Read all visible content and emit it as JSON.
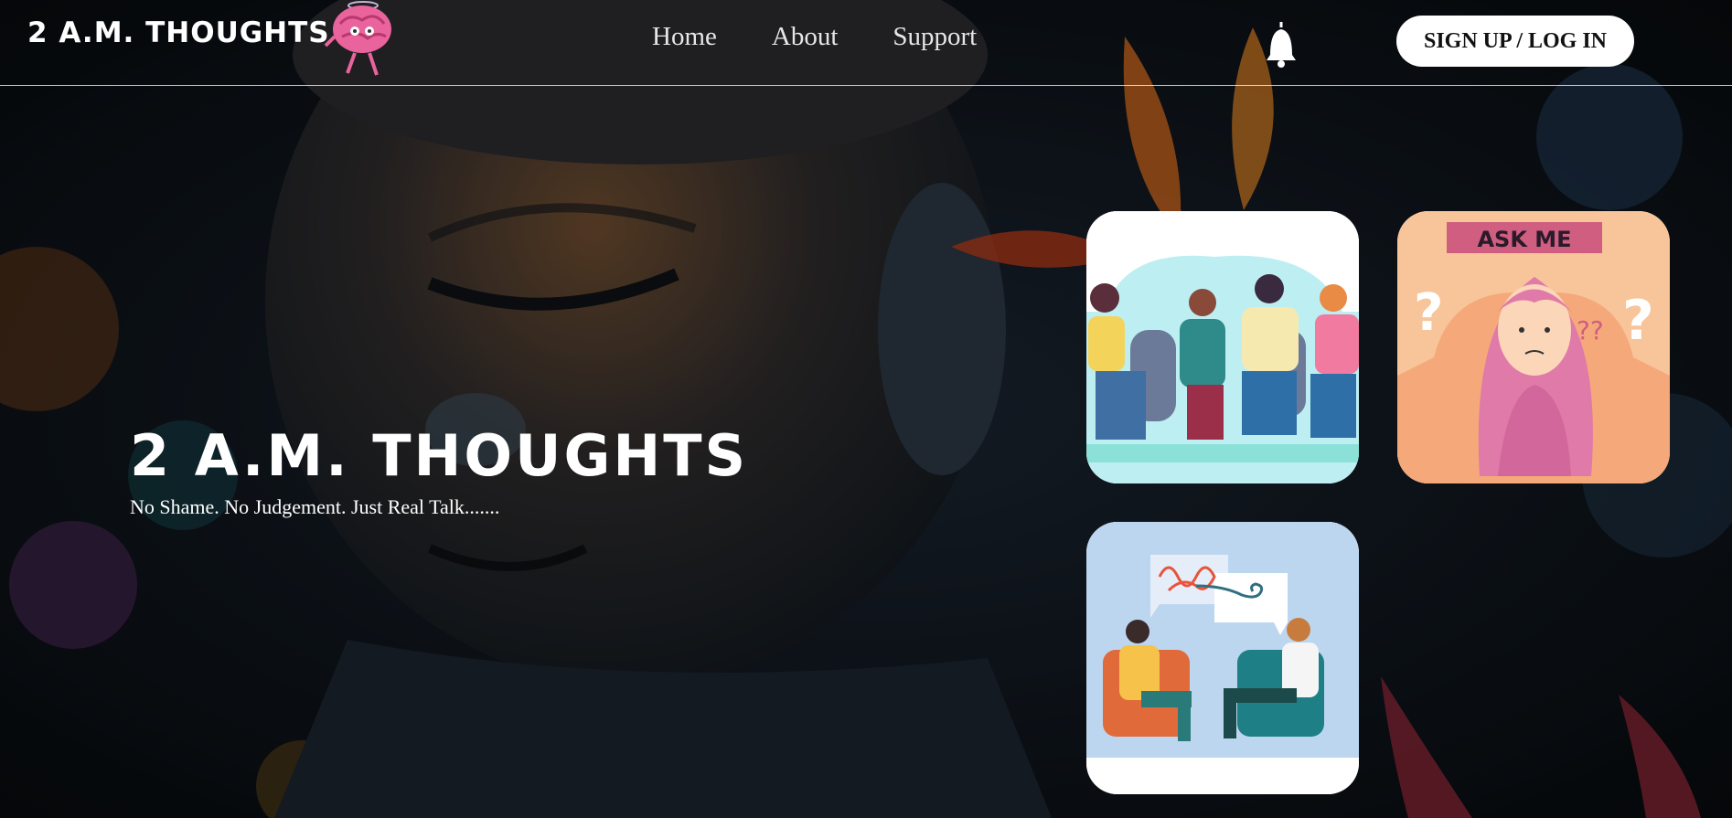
{
  "brand": {
    "name": "2 A.M. THOUGHTS",
    "logo_icon": "brain-mascot-icon"
  },
  "nav": {
    "links": [
      {
        "label": "Home"
      },
      {
        "label": "About"
      },
      {
        "label": "Support"
      }
    ],
    "bell_icon": "bell-icon",
    "cta_label": "SIGN UP / LOG IN"
  },
  "hero": {
    "title": "2 A.M. THOUGHTS",
    "tagline": "No Shame. No Judgement. Just Real Talk......."
  },
  "cards": {
    "group": {
      "name": "group-therapy-illustration"
    },
    "ask": {
      "banner": "ASK ME",
      "qmark_left": "?",
      "qmark_right": "?",
      "qmark_small": "??"
    },
    "counsel": {
      "name": "counseling-session-illustration"
    }
  },
  "colors": {
    "accent_pink": "#e9639c",
    "card_peach": "#f8c49a",
    "banner_rose": "#cf5e80",
    "sky_blue": "#bcd6ef"
  }
}
